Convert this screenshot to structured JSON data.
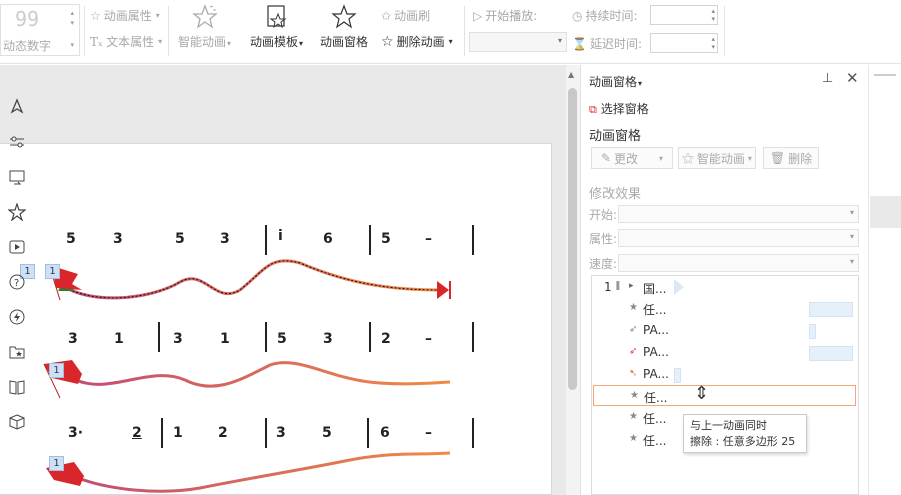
{
  "ribbon": {
    "counter_value": "99",
    "counter_label": "动态数字",
    "anim_props": "动画属性",
    "text_props": "文本属性",
    "smart_anim": "智能动画",
    "anim_template": "动画模板",
    "anim_pane": "动画窗格",
    "anim_brush": "动画刷",
    "delete_anim": "删除动画",
    "start_play": "开始播放:",
    "duration": "持续时间:",
    "delay": "延迟时间:"
  },
  "slide": {
    "row1_notes": [
      "5",
      "3",
      "5",
      "3",
      "i",
      "6",
      "5",
      "–"
    ],
    "row2_notes": [
      "3",
      "1",
      "3",
      "1",
      "5",
      "3",
      "2",
      "–"
    ],
    "row3_notes": [
      "3·",
      "2",
      "1",
      "2",
      "3",
      "5",
      "6",
      "–"
    ],
    "badges": [
      "1",
      "1",
      "1",
      "1"
    ]
  },
  "pane": {
    "header": "动画窗格",
    "select_pane": "选择窗格",
    "section_title": "动画窗格",
    "change_btn": "更改",
    "smart_btn": "智能动画",
    "delete_btn": "删除",
    "modify_title": "修改效果",
    "start_label": "开始:",
    "prop_label": "属性:",
    "speed_label": "速度:",
    "list": [
      {
        "num": "1",
        "label": "国..."
      },
      {
        "label": "任..."
      },
      {
        "label": "PA..."
      },
      {
        "label": "PA..."
      },
      {
        "label": "PA..."
      },
      {
        "label": "任..."
      },
      {
        "label": "任..."
      },
      {
        "label": "任..."
      }
    ],
    "tooltip_line1": "与上一动画同时",
    "tooltip_line2": "擦除 : 任意多边形 25"
  },
  "colors": {
    "accent_red": "#d9262b",
    "curve_start": "#c94a6a",
    "curve_end": "#f0884a",
    "selection": "#f4a57a"
  }
}
